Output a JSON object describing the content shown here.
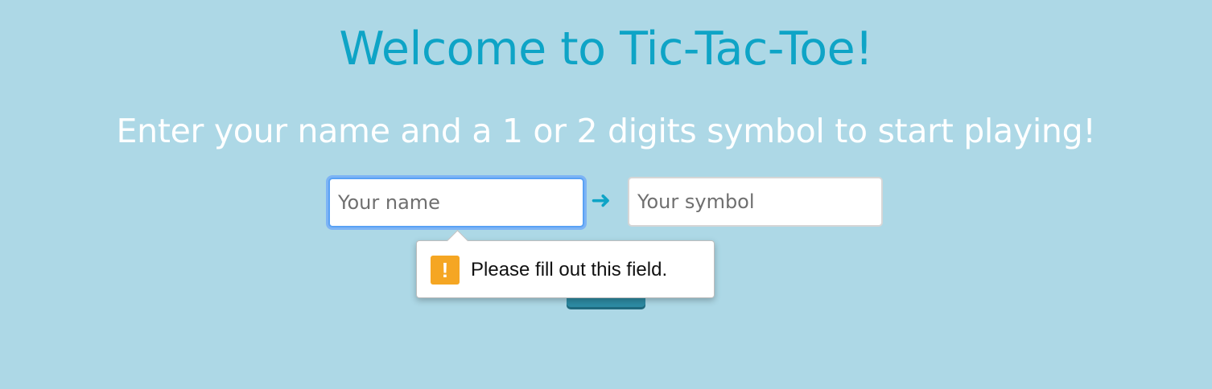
{
  "page": {
    "title": "Welcome to Tic-Tac-Toe!",
    "subtitle": "Enter your name and a 1 or 2 digits symbol to start playing!"
  },
  "form": {
    "name_placeholder": "Your name",
    "name_value": "",
    "arrow_glyph": "➜",
    "symbol_placeholder": "Your symbol",
    "symbol_value": ""
  },
  "validation_tooltip": {
    "icon": "warning-icon",
    "icon_glyph": "!",
    "message": "Please fill out this field."
  },
  "colors": {
    "background": "#add8e6",
    "accent": "#0ea4c6",
    "button": "#2d8ba3",
    "warning": "#f5a623"
  }
}
